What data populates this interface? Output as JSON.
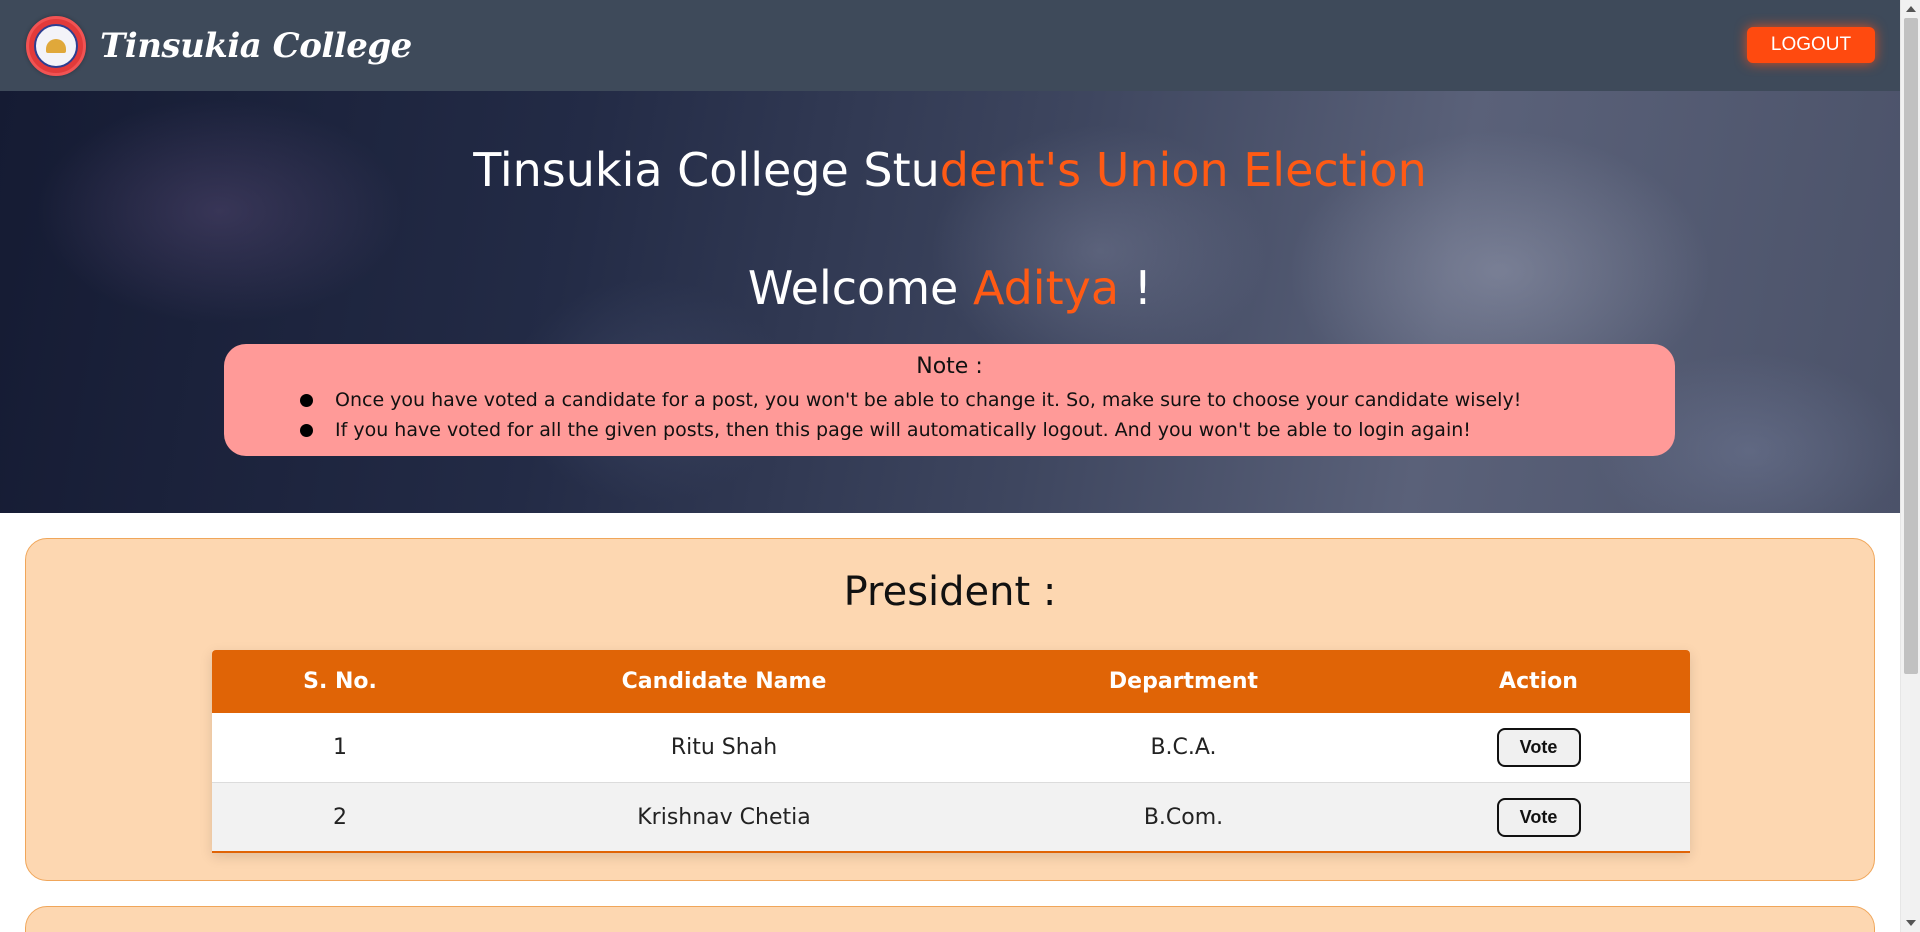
{
  "header": {
    "brand": "Tinsukia College",
    "logout_label": "LOGOUT"
  },
  "hero": {
    "title_part1": "Tinsukia College Stu",
    "title_part2": "dent's Union Election",
    "welcome_prefix": "Welcome ",
    "user_name": "Aditya",
    "welcome_suffix": " !"
  },
  "note": {
    "title": "Note :",
    "items": [
      "Once you have voted a candidate for a post, you won't be able to change it. So, make sure to choose your candidate wisely!",
      "If you have voted for all the given posts, then this page will automatically logout. And you won't be able to login again!"
    ]
  },
  "post": {
    "title": "President :",
    "columns": [
      "S. No.",
      "Candidate Name",
      "Department",
      "Action"
    ],
    "rows": [
      {
        "sno": "1",
        "name": "Ritu Shah",
        "department": "B.C.A.",
        "action": "Vote"
      },
      {
        "sno": "2",
        "name": "Krishnav Chetia",
        "department": "B.Com.",
        "action": "Vote"
      }
    ]
  },
  "colors": {
    "header_bg": "#3e4a5a",
    "accent": "#ff5a14",
    "table_header": "#e06406",
    "post_bg": "#fdd7b1",
    "note_bg": "#ff9a98"
  }
}
